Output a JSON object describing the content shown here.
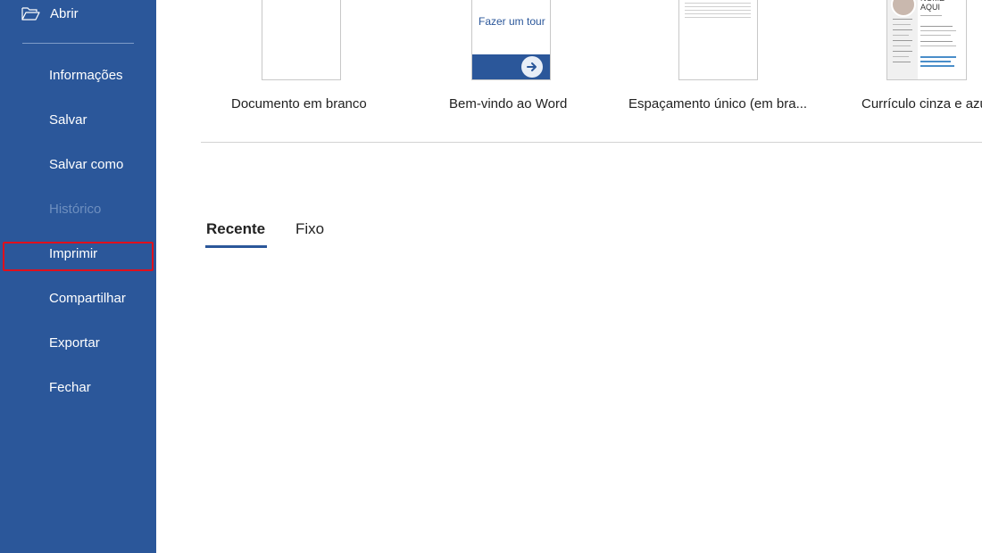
{
  "sidebar": {
    "open_label": "Abrir",
    "items": [
      {
        "label": "Informações",
        "enabled": true
      },
      {
        "label": "Salvar",
        "enabled": true
      },
      {
        "label": "Salvar como",
        "enabled": true
      },
      {
        "label": "Histórico",
        "enabled": false
      },
      {
        "label": "Imprimir",
        "enabled": true,
        "highlighted": true
      },
      {
        "label": "Compartilhar",
        "enabled": true
      },
      {
        "label": "Exportar",
        "enabled": true
      },
      {
        "label": "Fechar",
        "enabled": true
      }
    ]
  },
  "templates": [
    {
      "label": "Documento em branco"
    },
    {
      "label": "Bem-vindo ao Word",
      "thumb_text": "Fazer um tour"
    },
    {
      "label": "Espaçamento único (em bra..."
    },
    {
      "label": "Currículo cinza e azul",
      "thumb_text": "NOME AQUI"
    }
  ],
  "tabs": [
    {
      "label": "Recente",
      "active": true
    },
    {
      "label": "Fixo",
      "active": false
    }
  ],
  "colors": {
    "sidebar_bg": "#2b579a",
    "highlight_border": "#e0101c",
    "accent": "#2b579a"
  },
  "icons": {
    "open": "folder-open-icon",
    "tour_arrow": "arrow-right-icon"
  }
}
